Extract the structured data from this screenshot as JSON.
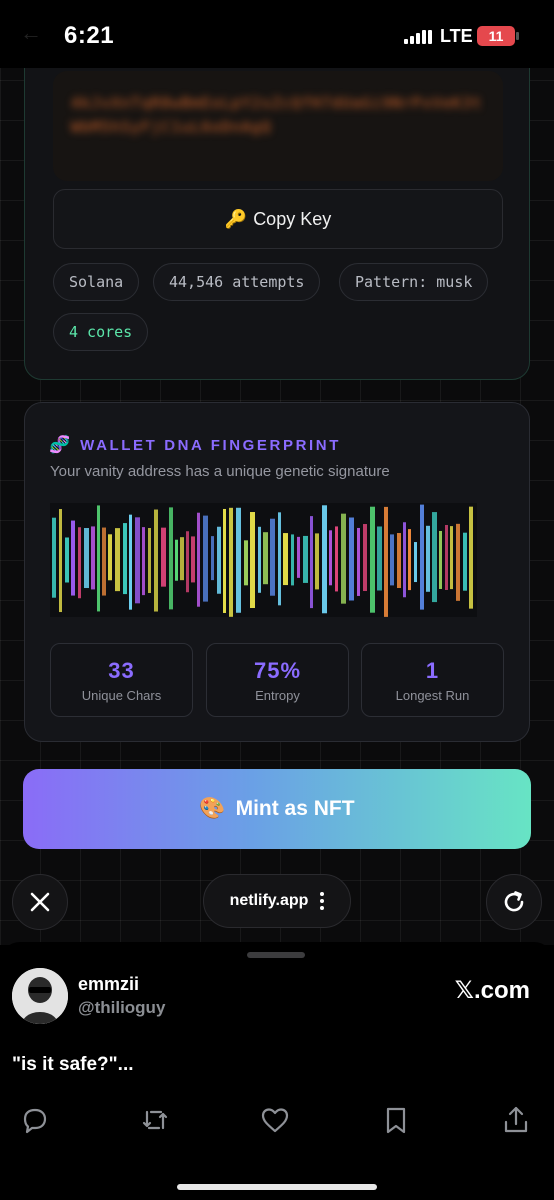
{
  "status_bar": {
    "time": "6:21",
    "network": "LTE",
    "battery": "11"
  },
  "key_card": {
    "private_key_blurred": "4kJvXnTqR8wBmEoLpY2sZcQfH7dUaGi9NrPxVeK3tWbM5hSyFjC1uL6oDnAgQ",
    "copy_button_label": "Copy Key",
    "copy_button_icon": "key-icon",
    "chips": [
      "Solana",
      "44,546 attempts",
      "Pattern: musk",
      "4 cores"
    ]
  },
  "dna_card": {
    "icon": "dna-icon",
    "title": "WALLET DNA FINGERPRINT",
    "subtitle": "Your vanity address has a unique genetic signature",
    "stats": [
      {
        "value": "33",
        "label": "Unique Chars"
      },
      {
        "value": "75%",
        "label": "Entropy"
      },
      {
        "value": "1",
        "label": "Longest Run"
      }
    ]
  },
  "mint_button": {
    "label": "Mint as NFT",
    "icon": "palette-icon"
  },
  "browser": {
    "url": "netlify.app"
  },
  "post": {
    "name": "emmzii",
    "handle": "@thilioguy",
    "source": "𝕏.com",
    "text": "\"is it safe?\"..."
  },
  "colors": {
    "accent_purple": "#8b6cff",
    "accent_green": "#5be5a9",
    "mint_gradient_start": "#8a6cf7",
    "mint_gradient_end": "#67e4c4"
  }
}
